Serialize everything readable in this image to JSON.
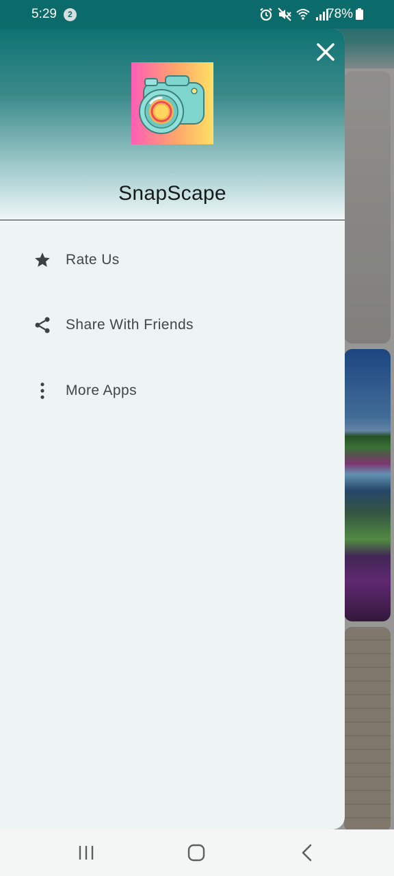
{
  "status_bar": {
    "time": "5:29",
    "notification_count": "2",
    "icons": [
      "alarm-icon",
      "mute-icon",
      "wifi-icon",
      "signal-icon"
    ],
    "battery": "78%"
  },
  "drawer": {
    "app_name": "SnapScape",
    "menu": [
      {
        "label": "Rate Us",
        "icon": "star-icon"
      },
      {
        "label": "Share With Friends",
        "icon": "share-icon"
      },
      {
        "label": "More Apps",
        "icon": "more-vert-icon"
      }
    ]
  },
  "nav_bar": {
    "buttons": [
      "recent-apps-icon",
      "home-icon",
      "back-icon"
    ]
  },
  "colors": {
    "header_teal": "#0e7272",
    "drawer_bg": "#edf4f3",
    "menu_text": "#3f4748",
    "icon_dark": "#3a4244"
  }
}
